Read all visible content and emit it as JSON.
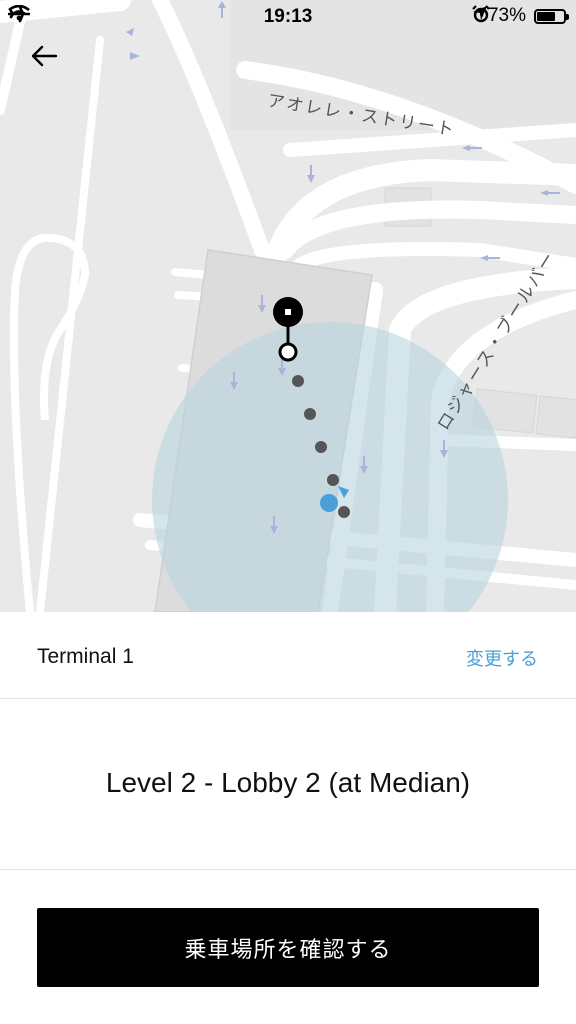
{
  "status_bar": {
    "time": "19:13",
    "battery_percent": "73%",
    "battery_level": 0.73,
    "icons": [
      "airplane-icon",
      "wifi-icon",
      "location-arrow-icon",
      "alarm-icon",
      "battery-icon"
    ]
  },
  "map": {
    "street_labels": [
      "アオレレ・ストリート",
      "ロジャース・ブールバー"
    ],
    "colors": {
      "road": "#ffffff",
      "background": "#e9e9e9",
      "accuracy_circle": "#b9d3e0",
      "location_dot": "#4a9fd8",
      "route_dots": "#555555"
    }
  },
  "nav": {
    "back_icon": "arrow-left-icon"
  },
  "terminal": {
    "name": "Terminal 1",
    "change_label": "変更する"
  },
  "pickup": {
    "location": "Level 2 - Lobby 2 (at Median)"
  },
  "confirm_button": {
    "label": "乗車場所を確認する"
  }
}
